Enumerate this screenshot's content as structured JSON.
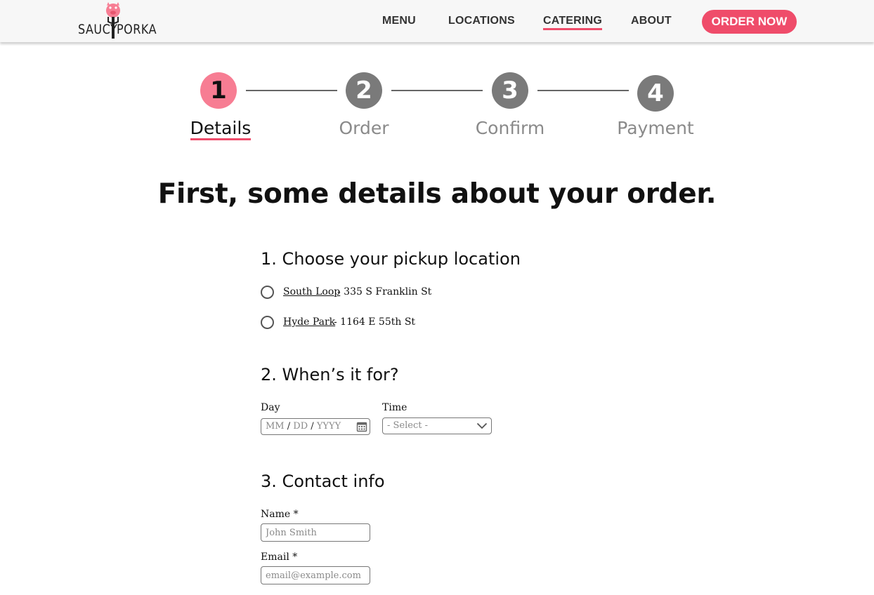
{
  "header": {
    "logo": {
      "left_text": "SAUCY",
      "right_text": "PORKA"
    },
    "nav": [
      {
        "label": "MENU"
      },
      {
        "label": "LOCATIONS"
      },
      {
        "label": "CATERING",
        "active": true
      },
      {
        "label": "ABOUT"
      }
    ],
    "order_button": "ORDER NOW"
  },
  "stepper": {
    "current_step": 1,
    "steps": [
      {
        "number": "1",
        "label": "Details"
      },
      {
        "number": "2",
        "label": "Order"
      },
      {
        "number": "3",
        "label": "Confirm"
      },
      {
        "number": "4",
        "label": "Payment"
      }
    ]
  },
  "page_title": "First, some details about your order.",
  "location_section": {
    "title": "1. Choose your pickup location",
    "options": [
      {
        "name": "South Loop",
        "address": "- 335 S Franklin St",
        "selected": false
      },
      {
        "name": "Hyde Park",
        "address": "- 1164 E 55th St",
        "selected": false
      }
    ]
  },
  "when_section": {
    "title": "2. When’s it for?",
    "day_label": "Day",
    "day_parts": {
      "mm": "MM",
      "dd": "DD",
      "yyyy": "YYYY",
      "separator": "/"
    },
    "time_label": "Time",
    "time_selected": "- Select -"
  },
  "contact_section": {
    "title": "3. Contact info",
    "name_label": "Name *",
    "name_placeholder": "John Smith",
    "email_label": "Email *",
    "email_placeholder": "email@example.com"
  },
  "colors": {
    "accent": "#ef4c6a",
    "active_step": "#f77d93",
    "inactive_step": "#7a7a7a"
  },
  "icons": {
    "logo": "pig-on-fork-logo",
    "calendar": "calendar-icon",
    "dropdown": "chevron-down-icon"
  }
}
